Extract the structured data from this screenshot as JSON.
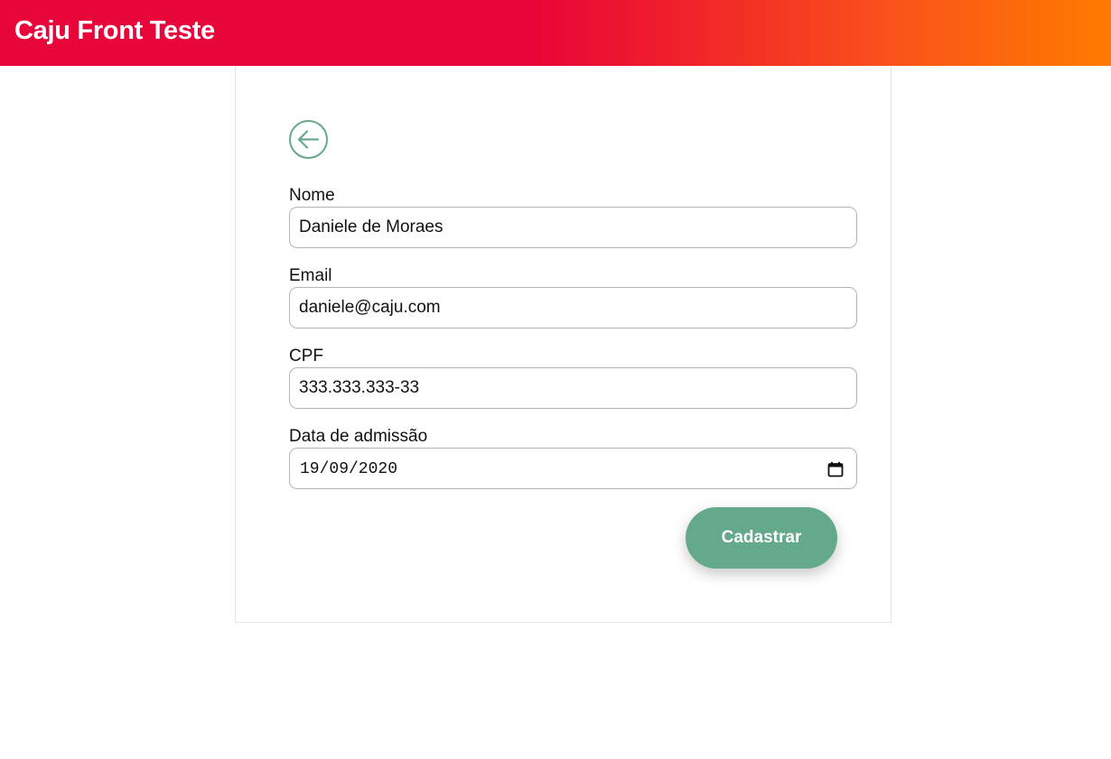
{
  "header": {
    "title": "Caju Front Teste"
  },
  "form": {
    "back_icon": "arrow-left-circle-icon",
    "fields": {
      "nome": {
        "label": "Nome",
        "value": "Daniele de Moraes"
      },
      "email": {
        "label": "Email",
        "value": "daniele@caju.com"
      },
      "cpf": {
        "label": "CPF",
        "value": "333.333.333-33"
      },
      "admissao": {
        "label": "Data de admissão",
        "value": "19/09/2020",
        "icon": "calendar-icon"
      }
    },
    "submit_label": "Cadastrar"
  },
  "colors": {
    "header_gradient_start": "#e80539",
    "header_gradient_end": "#ff7b00",
    "accent": "#64a98c"
  }
}
